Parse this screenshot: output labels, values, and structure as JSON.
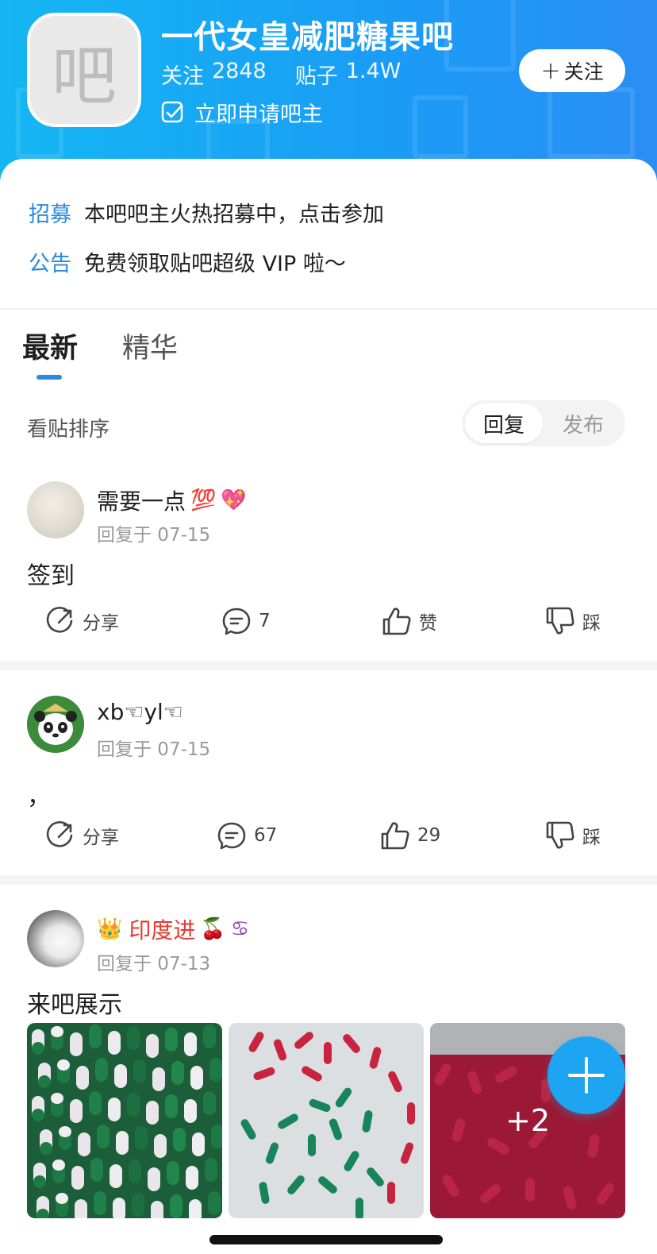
{
  "header": {
    "logo_char": "吧",
    "bar_name": "一代女皇减肥糖果吧",
    "follow_label": "关注",
    "follow_count": "2848",
    "posts_label": "贴子",
    "posts_count": "1.4W",
    "apply_text": "立即申请吧主",
    "follow_button": "关注",
    "colors": {
      "gradient_start": "#15b6f3",
      "gradient_end": "#2a8ef5"
    }
  },
  "notices": [
    {
      "tag": "招募",
      "text": "本吧吧主火热招募中，点击参加"
    },
    {
      "tag": "公告",
      "text": "免费领取贴吧超级 VIP 啦～"
    }
  ],
  "tabs": [
    {
      "label": "最新",
      "active": true
    },
    {
      "label": "精华",
      "active": false
    }
  ],
  "sort": {
    "label": "看贴排序",
    "options": [
      {
        "label": "回复",
        "selected": true
      },
      {
        "label": "发布",
        "selected": false
      }
    ]
  },
  "posts": [
    {
      "username": "需要一点",
      "emojis": [
        "💯",
        "💖"
      ],
      "time": "回复于 07-15",
      "body": "签到",
      "actions": {
        "share": "分享",
        "comments": "7",
        "like": "赞",
        "dislike": "踩"
      },
      "avatar_icon": "avatar-grey"
    },
    {
      "username": "xb☜yl☜",
      "emojis": [],
      "time": "回复于 07-15",
      "body": "，",
      "actions": {
        "share": "分享",
        "comments": "67",
        "like": "29",
        "dislike": "踩"
      },
      "avatar_icon": "panda-avatar"
    },
    {
      "username": "印度进",
      "badge": "👑",
      "emojis": [
        "🍒",
        "♋"
      ],
      "time": "回复于 07-13",
      "body": "来吧展示",
      "images": [
        {
          "desc_icon": "green-white-capsules"
        },
        {
          "desc_icon": "red-green-capsules"
        },
        {
          "desc_icon": "red-capsules",
          "more_count": "+2"
        }
      ],
      "username_color": "#e8382f"
    }
  ],
  "fab": {
    "icon": "plus-icon"
  }
}
